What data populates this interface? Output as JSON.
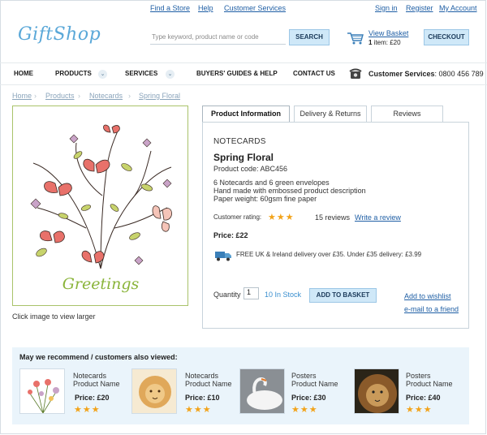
{
  "top_links": [
    "Find a Store",
    "Help",
    "Customer Services",
    "Sign in",
    "Register",
    "My Account"
  ],
  "logo": "GiftShop",
  "search": {
    "placeholder": "Type keyword, product name or code",
    "button": "SEARCH"
  },
  "basket": {
    "view_label": "View Basket",
    "count": "1",
    "count_suffix": " item: £20",
    "checkout": "CHECKOUT"
  },
  "nav": {
    "items": [
      "HOME",
      "PRODUCTS",
      "SERVICES",
      "BUYERS' GUIDES & HELP",
      "CONTACT US"
    ],
    "chevron": "⌄",
    "cs_label": "Customer Services",
    "cs_phone": ": 0800 456 789"
  },
  "breadcrumb": [
    "Home",
    "Notecards",
    "Products",
    "Spring Floral"
  ],
  "breadcrumb_sep": "›",
  "product_image": {
    "card_text": "Greetings",
    "caption": "Click image to view larger"
  },
  "tabs": [
    "Product Information",
    "Delivery & Returns",
    "Reviews"
  ],
  "product": {
    "type": "NOTECARDS",
    "name": "Spring Floral",
    "code": "Product code: ABC456",
    "description": [
      "6 Notecards and 6 green envelopes",
      "Hand made with embossed product description",
      "Paper weight: 60gsm fine paper"
    ],
    "rating_label": "Customer rating:",
    "rating_stars": "★★★",
    "rating_value": 3,
    "reviews": "15 reviews",
    "write_review": "Write a review",
    "price": "Price: £22",
    "delivery": "FREE UK & Ireland delivery over £35. Under £35 delivery: £3.99",
    "quantity_label": "Quantity",
    "quantity_value": "1",
    "stock": "10 In Stock",
    "add_to_basket": "ADD TO BASKET",
    "wishlist": "Add to wishlist",
    "email_friend": "e-mail to a friend"
  },
  "recommend": {
    "title": "May we recommend / customers also viewed:",
    "items": [
      {
        "category": "Notecards",
        "name": "Product Name",
        "price": "Price: £20",
        "stars": "★★★"
      },
      {
        "category": "Notecards",
        "name": "Product Name",
        "price": "Price: £10",
        "stars": "★★★"
      },
      {
        "category": "Posters",
        "name": "Product Name",
        "price": "Price: £30",
        "stars": "★★★"
      },
      {
        "category": "Posters",
        "name": "Product Name",
        "price": "Price: £40",
        "stars": "★★★"
      }
    ]
  },
  "colors": {
    "accent": "#1f5fa5",
    "button_bg": "#cfe8f8",
    "star": "#f2a31a",
    "recommend_bg": "#eaf4fb",
    "image_border": "#a9c36a"
  }
}
